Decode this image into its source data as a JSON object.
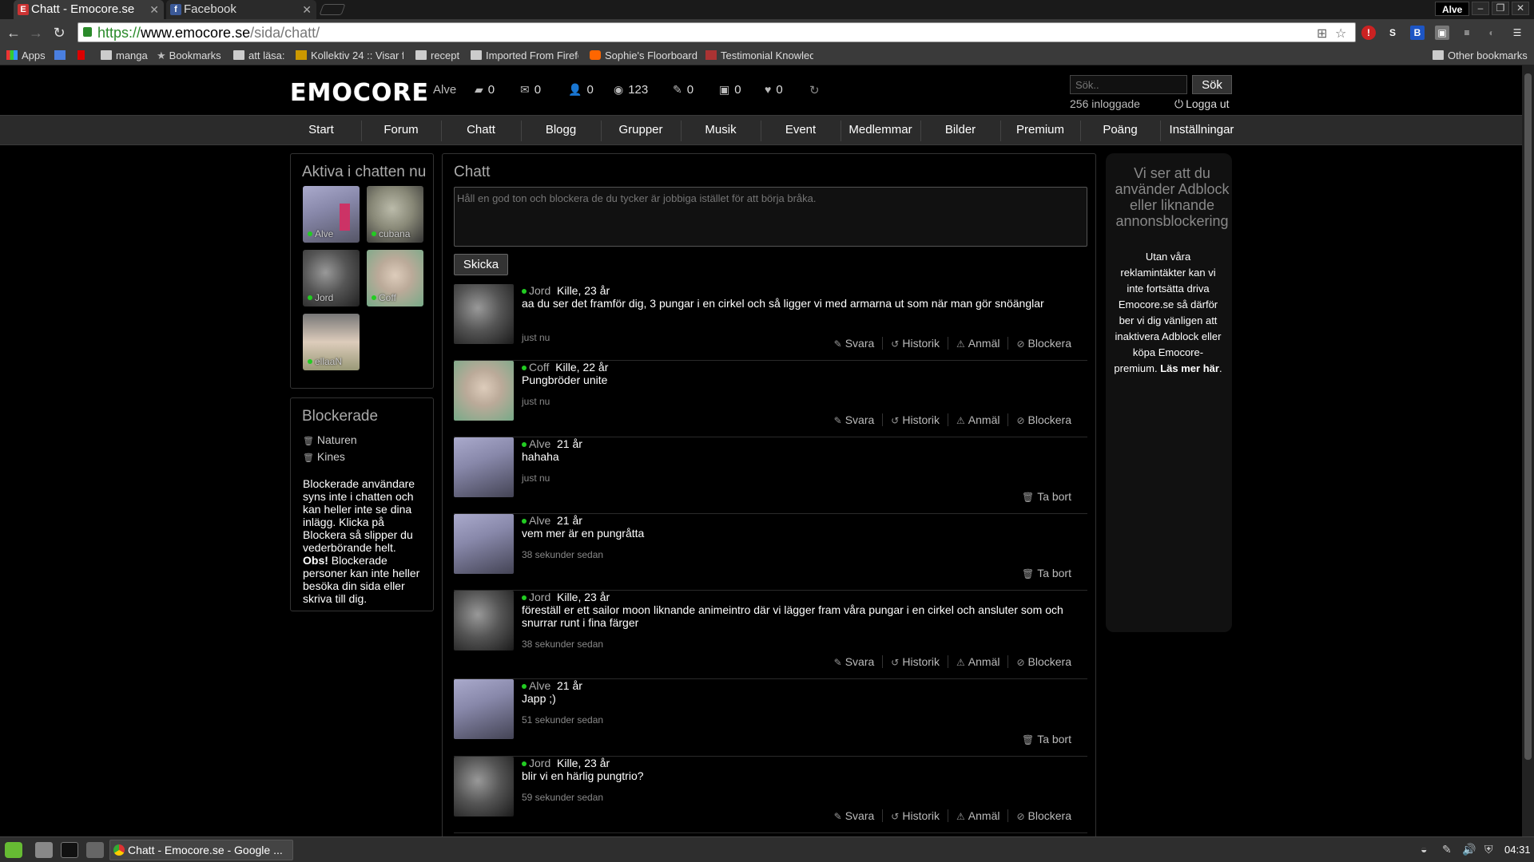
{
  "browser": {
    "tabs": [
      {
        "title": "Chatt - Emocore.se",
        "favicon": "E"
      },
      {
        "title": "Facebook",
        "favicon": "f"
      }
    ],
    "profile_name": "Alve",
    "url_scheme": "https://",
    "url_host": "www.emocore.se",
    "url_path": "/sida/chatt/",
    "bookmarks": [
      "Apps",
      "manga",
      "Bookmarks",
      "att läsa:",
      "Kollektiv 24 :: Visar fö",
      "recept",
      "Imported From Firefo",
      "Sophie's Floorboard",
      "Testimonial Knowled",
      "Other bookmarks"
    ]
  },
  "header": {
    "logo": "EMOCORE",
    "user": "Alve",
    "stats": {
      "posts": "0",
      "mail": "0",
      "friends": "0",
      "visitors": "123",
      "guestbook": "0",
      "photos": "0",
      "likes": "0"
    },
    "search_placeholder": "Sök..",
    "search_button": "Sök",
    "online_count": "256 inloggade",
    "logout": "Logga ut"
  },
  "nav": [
    "Start",
    "Forum",
    "Chatt",
    "Blogg",
    "Grupper",
    "Musik",
    "Event",
    "Medlemmar",
    "Bilder",
    "Premium",
    "Poäng",
    "Inställningar"
  ],
  "active_panel": {
    "title": "Aktiva i chatten nu",
    "users": [
      "Alve",
      "cubana",
      "Jord",
      "Coff",
      "ellaaN"
    ]
  },
  "blocked_panel": {
    "title": "Blockerade",
    "users": [
      "Naturen",
      "Kines"
    ],
    "info": "Blockerade användare syns inte i chatten och kan heller inte se dina inlägg. Klicka på Blockera så slipper du vederbörande helt.",
    "obs_label": "Obs!",
    "obs_text": " Blockerade personer kan inte heller besöka din sida eller skriva till dig."
  },
  "chat": {
    "title": "Chatt",
    "input_placeholder": "Håll en god ton och blockera de du tycker är jobbiga istället för att börja bråka.",
    "send_button": "Skicka",
    "action_labels": {
      "reply": "Svara",
      "history": "Historik",
      "report": "Anmäl",
      "block": "Blockera",
      "delete": "Ta bort"
    },
    "messages": [
      {
        "user": "Jord",
        "info": "Kille, 23 år",
        "text": "aa du ser det framför dig, 3 pungar i en cirkel och så ligger vi med armarna ut som när man gör snöänglar",
        "time": "just nu",
        "own": false
      },
      {
        "user": "Coff",
        "info": "Kille, 22 år",
        "text": "Pungbröder unite",
        "time": "just nu",
        "own": false
      },
      {
        "user": "Alve",
        "info": "21 år",
        "text": "hahaha",
        "time": "just nu",
        "own": true
      },
      {
        "user": "Alve",
        "info": "21 år",
        "text": "vem mer är en pungråtta",
        "time": "38 sekunder sedan",
        "own": true
      },
      {
        "user": "Jord",
        "info": "Kille, 23 år",
        "text": "föreställ er ett sailor moon liknande animeintro där vi lägger fram våra pungar i en cirkel och ansluter som och snurrar runt i fina färger",
        "time": "38 sekunder sedan",
        "own": false
      },
      {
        "user": "Alve",
        "info": "21 år",
        "text": "Japp ;)",
        "time": "51 sekunder sedan",
        "own": true
      },
      {
        "user": "Jord",
        "info": "Kille, 23 år",
        "text": "blir vi en härlig pungtrio?",
        "time": "59 sekunder sedan",
        "own": false
      }
    ]
  },
  "adblock": {
    "title": "Vi ser att du använder Adblock eller liknande annonsblockering",
    "text": "Utan våra reklamintäkter kan vi inte fortsätta driva Emocore.se så därför ber vi dig vänligen att inaktivera Adblock eller köpa Emocore-premium.",
    "link": "Läs mer här"
  },
  "taskbar": {
    "task_title": "Chatt - Emocore.se - Google ...",
    "clock": "04:31"
  },
  "colors": {
    "online_dot": "#22cc22",
    "nav_bg": "#2b2b2b",
    "page_bg": "#000000"
  }
}
